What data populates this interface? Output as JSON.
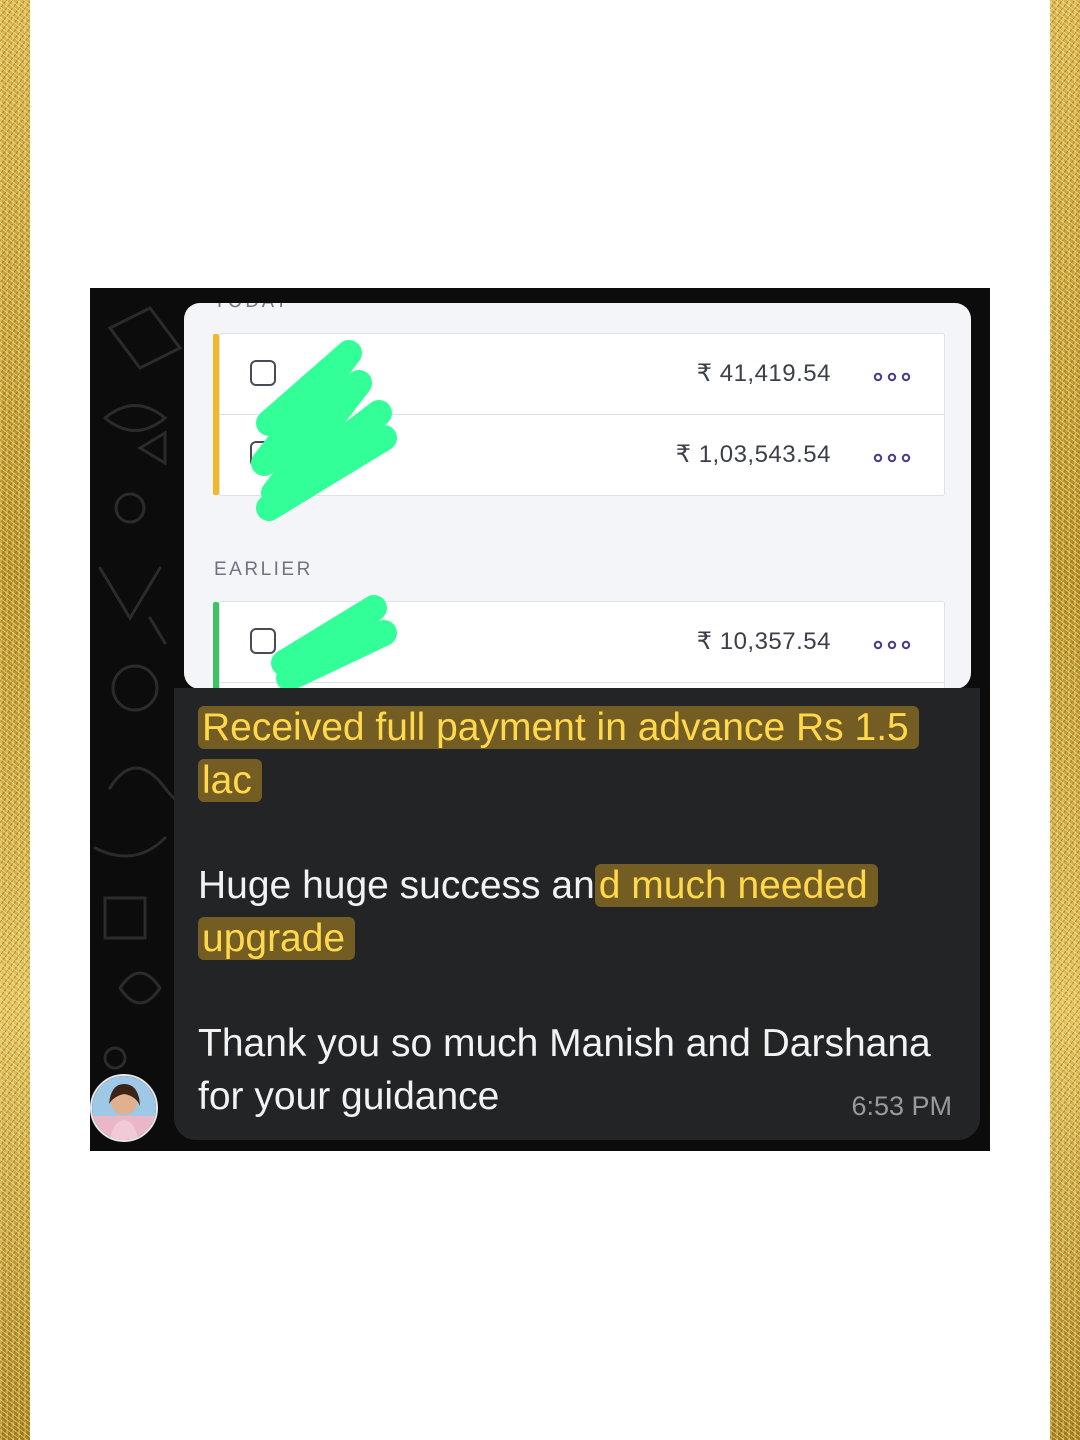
{
  "card": {
    "cut_header": "TODAY",
    "section_label": "EARLIER",
    "today_rows": [
      {
        "amount": "₹ 41,419.54",
        "marker_color": "#f5b72a"
      },
      {
        "amount": "₹ 1,03,543.54",
        "marker_color": "#f5b72a"
      }
    ],
    "earlier_rows": [
      {
        "amount": "₹ 10,357.54",
        "marker_color": "#3ec364"
      }
    ],
    "redaction_color": "#33ff99"
  },
  "chat": {
    "messages": [
      {
        "plain_before": "",
        "highlight": "Received full payment in advance Rs 1.5 lac",
        "plain_after": ""
      },
      {
        "plain_before": "Huge huge success an",
        "highlight": "d much needed upgrade",
        "plain_after": ""
      },
      {
        "plain_before": "Thank you so much Manish and Darshana for your guidance",
        "highlight": "",
        "plain_after": ""
      }
    ],
    "timestamp": "6:53 PM",
    "highlight_color": "#ffd84d"
  }
}
